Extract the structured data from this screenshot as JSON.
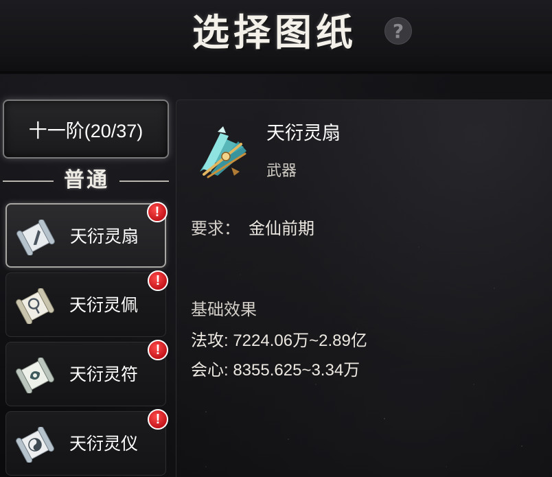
{
  "header": {
    "title": "选择图纸",
    "help_icon": "question-icon",
    "help_label": "?"
  },
  "tier": {
    "label": "十一阶(20/37)"
  },
  "section": {
    "title": "普通"
  },
  "recipes": [
    {
      "label": "天衍灵扇",
      "selected": true,
      "icon": "scroll-fan-icon",
      "badge": "!"
    },
    {
      "label": "天衍灵佩",
      "selected": false,
      "icon": "scroll-pendant-icon",
      "badge": "!"
    },
    {
      "label": "天衍灵符",
      "selected": false,
      "icon": "scroll-talisman-icon",
      "badge": "!"
    },
    {
      "label": "天衍灵仪",
      "selected": false,
      "icon": "scroll-taiji-icon",
      "badge": "!"
    }
  ],
  "detail": {
    "name": "天衍灵扇",
    "type": "武器",
    "requirement_label": "要求：",
    "requirement_value": "金仙前期",
    "effect_title": "基础效果",
    "stats": [
      "法攻: 7224.06万~2.89亿",
      "会心: 8355.625~3.34万"
    ]
  },
  "colors": {
    "badge_red": "#c4161c",
    "text_main": "#ffffff",
    "text_sub": "#d4d0c9",
    "selected_border": "#a9a7a3"
  }
}
